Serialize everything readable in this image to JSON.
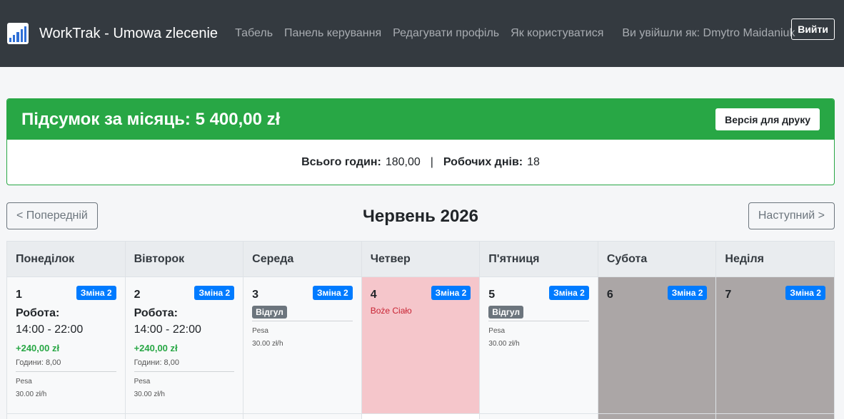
{
  "navbar": {
    "brand": "WorkTrak - Umowa zlecenie",
    "links": [
      "Табель",
      "Панель керування",
      "Редагувати профіль",
      "Як користуватися"
    ],
    "user_text": "Ви увійшли як: Dmytro Maidaniuk",
    "logout_label": "Вийти"
  },
  "summary": {
    "title": "Підсумок за місяць: 5 400,00 zł",
    "print_label": "Версія для друку",
    "hours_label": "Всього годин:",
    "hours_value": "180,00",
    "separator": "|",
    "days_label": "Робочих днів:",
    "days_value": "18"
  },
  "month_nav": {
    "prev_label": "< Попередній",
    "title": "Червень 2026",
    "next_label": "Наступний >"
  },
  "calendar": {
    "weekdays": [
      "Понеділок",
      "Вівторок",
      "Середа",
      "Четвер",
      "П'ятниця",
      "Субота",
      "Неділя"
    ],
    "days": [
      {
        "num": "1",
        "shift": "Зміна 2",
        "work_label": "Робота:",
        "time": "14:00 - 22:00",
        "earn": "+240,00 zł",
        "hours": "Години: 8,00",
        "rate_name": "Pesa",
        "rate": "30.00 zł/h"
      },
      {
        "num": "2",
        "shift": "Зміна 2",
        "work_label": "Робота:",
        "time": "14:00 - 22:00",
        "earn": "+240,00 zł",
        "hours": "Години: 8,00",
        "rate_name": "Pesa",
        "rate": "30.00 zł/h"
      },
      {
        "num": "3",
        "shift": "Зміна 2",
        "off": "Відгул",
        "rate_name": "Pesa",
        "rate": "30.00 zł/h"
      },
      {
        "num": "4",
        "shift": "Зміна 2",
        "holiday": "Boże Ciało"
      },
      {
        "num": "5",
        "shift": "Зміна 2",
        "off": "Відгул",
        "rate_name": "Pesa",
        "rate": "30.00 zł/h"
      },
      {
        "num": "6",
        "shift": "Зміна 2"
      },
      {
        "num": "7",
        "shift": "Зміна 2"
      }
    ]
  },
  "colors": {
    "navbar": "#343a40",
    "success": "#28a745",
    "primary": "#007bff",
    "secondary": "#6c757d",
    "holiday_bg": "#f5c6cb",
    "weekend_bg": "#aba6a6"
  },
  "icons": {
    "brand": "bar-chart-icon"
  }
}
